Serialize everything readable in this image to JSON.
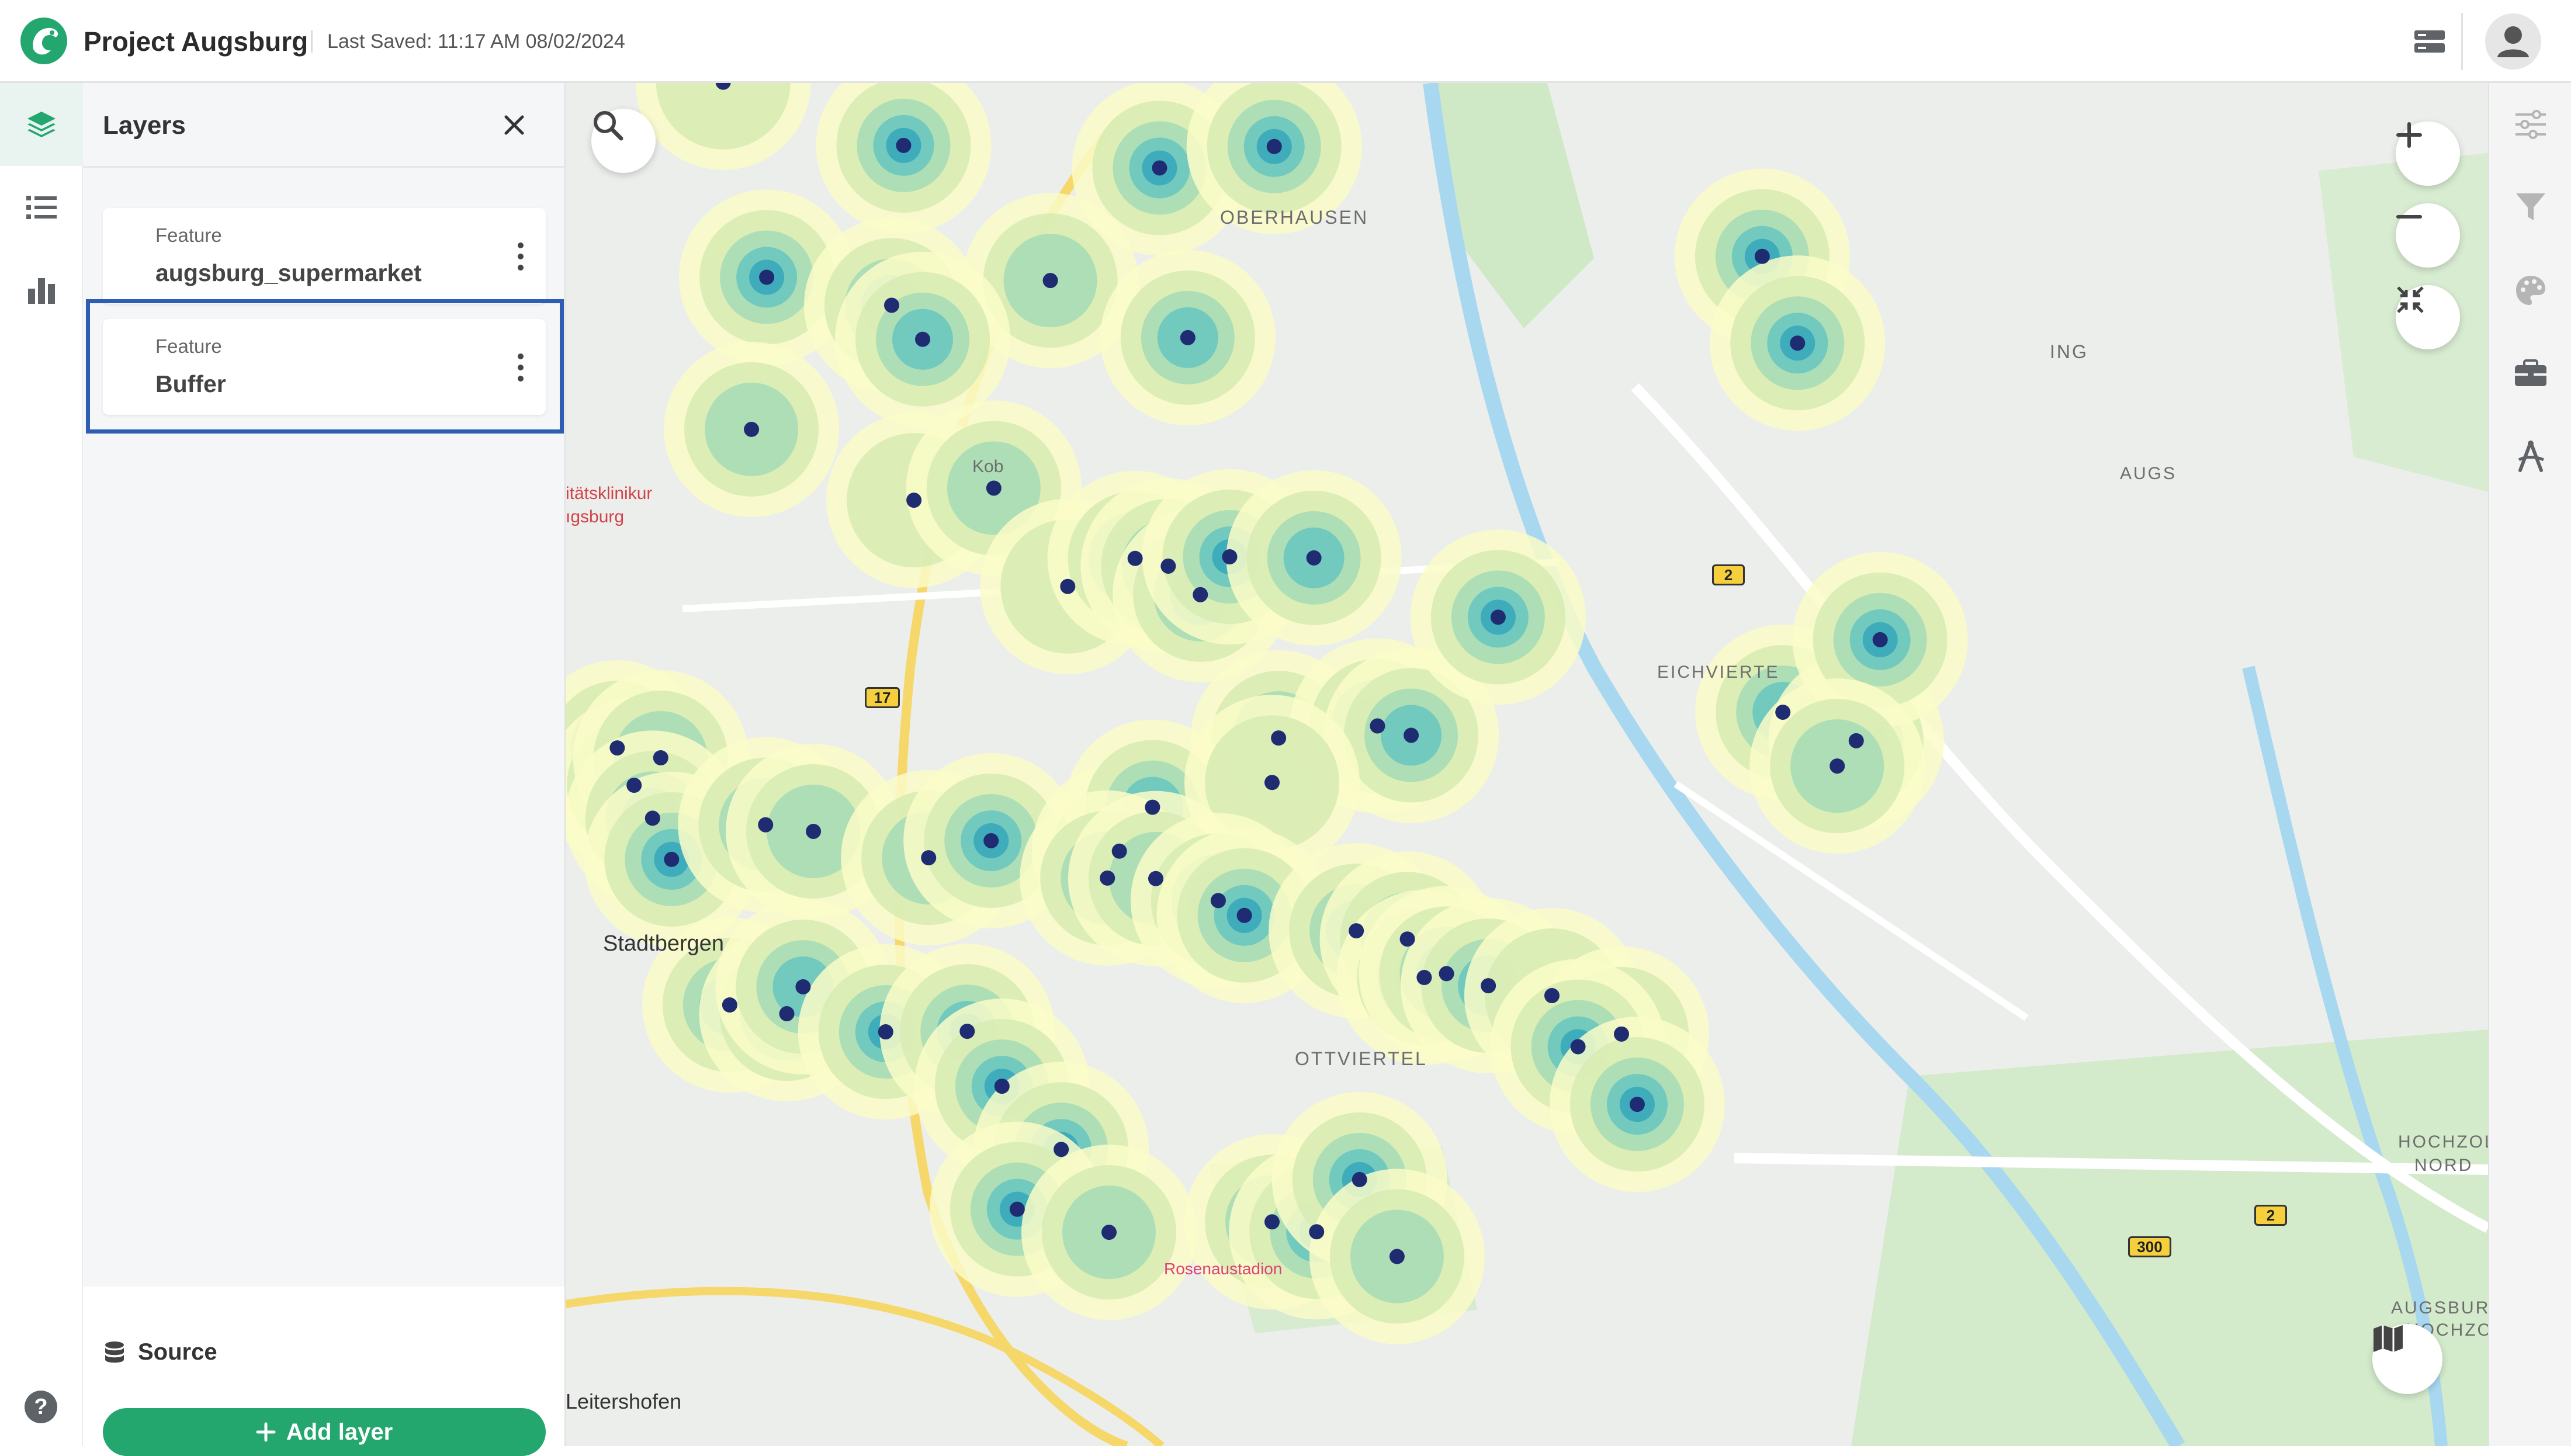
{
  "app": {
    "title": "Project Augsburg",
    "last_saved": "Last Saved: 11:17 AM 08/02/2024",
    "accent_color": "#23a76e"
  },
  "topbar_icons": [
    "storage-toggle-icon",
    "user-avatar-icon"
  ],
  "left_rail": {
    "items": [
      {
        "name": "layers-icon",
        "active": true
      },
      {
        "name": "list-icon",
        "active": false
      },
      {
        "name": "bar-chart-icon",
        "active": false
      }
    ],
    "help_label": "?"
  },
  "panel": {
    "title": "Layers",
    "layers": [
      {
        "kind": "Feature",
        "name": "augsburg_supermarket",
        "selected": false
      },
      {
        "kind": "Feature",
        "name": "Buffer",
        "selected": true
      }
    ],
    "footer": {
      "source_label": "Source",
      "add_layer_label": "Add layer"
    }
  },
  "map": {
    "labels": {
      "oberhausen": "OBERHAUSEN",
      "ing": "ING",
      "klinikum_1": "itätsklinikur",
      "klinikum_2": "ıgsburg",
      "kob": "Kob",
      "augsb": "AUGS",
      "eichvierte": "EICHVIERTE",
      "stadtbergen": "Stadtbergen",
      "ottviertel": "OTTVIERTEL",
      "rosenau": "Rosenaustadion",
      "hochzoll_1": "HOCHZOLL",
      "hochzoll_2": "NORD",
      "augsburg_hochzoll_1": "AUGSBUR",
      "augsburg_hochzoll_2": "HOCHZO",
      "leitershofen": "Leitershofen"
    },
    "road_badges": [
      "2",
      "17",
      "2",
      "300"
    ],
    "buffer_colors": [
      "#fafcc8",
      "#d8ecb4",
      "#a8dbb6",
      "#6cc7bf",
      "#3aa9bb",
      "#2f7fb8"
    ],
    "point_color": "#1f2c72",
    "controls": [
      "search-icon",
      "zoom-in-icon",
      "zoom-out-icon",
      "collapse-icon",
      "basemap-icon"
    ]
  },
  "right_rail": {
    "items": [
      "sliders-icon",
      "filter-icon",
      "palette-icon",
      "toolbox-icon",
      "draw-icon"
    ]
  }
}
